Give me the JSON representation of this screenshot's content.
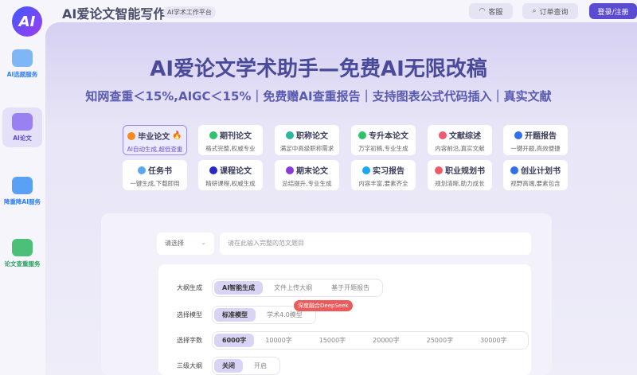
{
  "header": {
    "logo": "AI",
    "title": "AI爱论文智能写作",
    "badge": "AI学术工作平台",
    "service": "客服",
    "orders": "订单查询",
    "login": "登录/注册"
  },
  "sidebar": [
    {
      "label": "AI选题服务"
    },
    {
      "label": "AI论文"
    },
    {
      "label": "降重降AI服务"
    },
    {
      "label": "论文查重服务"
    }
  ],
  "hero": {
    "title": "AI爱论文学术助手—免费AI无限改稿",
    "subtitle": "知网查重＜15%,AIGC＜15%｜免费赠AI查重报告｜支持图表公式代码插入｜真实文献"
  },
  "cards": [
    {
      "title": "毕业论文",
      "desc": "AI自动生成,超低查重",
      "color": "#f58a1f"
    },
    {
      "title": "期刊论文",
      "desc": "格式完整,权威专业",
      "color": "#2bc46b"
    },
    {
      "title": "职称论文",
      "desc": "满足中高级职称需求",
      "color": "#2bb89a"
    },
    {
      "title": "专升本论文",
      "desc": "万字初稿,专业生成",
      "color": "#2bc46b"
    },
    {
      "title": "文献综述",
      "desc": "内容前沿,真实文献",
      "color": "#f05a6a"
    },
    {
      "title": "开题报告",
      "desc": "一键开题,高效便捷",
      "color": "#2f6ff0"
    },
    {
      "title": "任务书",
      "desc": "一键生成,下载即用",
      "color": "#5aa5f5"
    },
    {
      "title": "课程论文",
      "desc": "精研课程,权威生成",
      "color": "#2828c8"
    },
    {
      "title": "期末论文",
      "desc": "总结提升,专业生成",
      "color": "#8a3ad8"
    },
    {
      "title": "实习报告",
      "desc": "内容丰富,要素齐全",
      "color": "#1aa8f0"
    },
    {
      "title": "职业规划书",
      "desc": "规划清晰,助力成长",
      "color": "#f05a6a"
    },
    {
      "title": "创业计划书",
      "desc": "视野高端,要素包含",
      "color": "#2f6ff0"
    }
  ],
  "form": {
    "select": "请选择",
    "placeholder": "请在此输入完整的范文题目",
    "rows": [
      {
        "label": "大纲生成",
        "options": [
          "AI智能生成",
          "文件上传大纲",
          "基于开题报告"
        ]
      },
      {
        "label": "选择模型",
        "options": [
          "标准模型",
          "学术4.0模型"
        ]
      },
      {
        "label": "选择字数",
        "options": [
          "6000字",
          "10000字",
          "15000字",
          "20000字",
          "25000字",
          "30000字"
        ]
      },
      {
        "label": "三级大纲",
        "options": [
          "关闭",
          "开启"
        ]
      }
    ],
    "deepseek_badge": "深度融合DeepSeek"
  }
}
